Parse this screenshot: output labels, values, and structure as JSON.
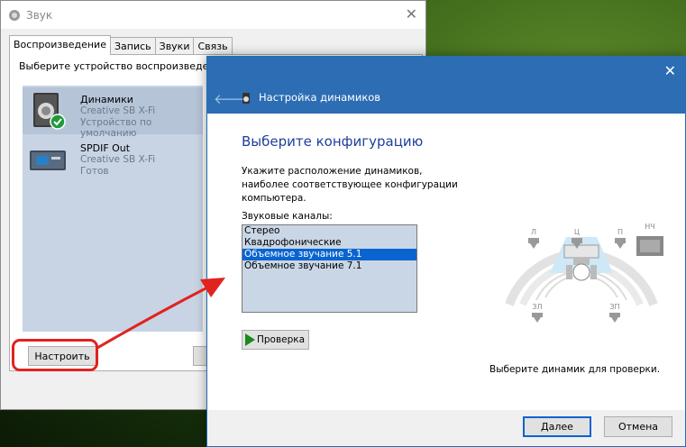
{
  "sound_window": {
    "title": "Звук",
    "tabs": [
      {
        "label": "Воспроизведение",
        "active": true
      },
      {
        "label": "Запись",
        "active": false
      },
      {
        "label": "Звуки",
        "active": false
      },
      {
        "label": "Связь",
        "active": false
      }
    ],
    "instruction": "Выберите устройство воспроизведения",
    "devices": [
      {
        "name": "Динамики",
        "driver": "Creative SB X-Fi",
        "status": "Устройство по умолчанию",
        "selected": true
      },
      {
        "name": "SPDIF Out",
        "driver": "Creative SB X-Fi",
        "status": "Готов",
        "selected": false
      }
    ],
    "configure_button": "Настроить"
  },
  "dialog": {
    "title": "Настройка динамиков",
    "heading": "Выберите конфигурацию",
    "description": "Укажите расположение динамиков, наиболее соответствующее конфигурации компьютера.",
    "channels_label": "Звуковые каналы:",
    "channels": [
      {
        "label": "Стерео",
        "selected": false
      },
      {
        "label": "Квадрофонические",
        "selected": false
      },
      {
        "label": "Объемное звучание 5.1",
        "selected": true
      },
      {
        "label": "Объемное звучание 7.1",
        "selected": false
      }
    ],
    "test_button": "Проверка",
    "speaker_labels": {
      "subwoofer": "НЧ",
      "front_left": "Л",
      "center": "Ц",
      "front_right": "П",
      "rear_left": "ЗЛ",
      "rear_right": "ЗП"
    },
    "test_hint": "Выберите динамик для проверки.",
    "next_button": "Далее",
    "cancel_button": "Отмена"
  },
  "colors": {
    "header_blue": "#2d6db4",
    "heading_blue": "#1e3f9a",
    "selection_blue": "#0a64d0",
    "highlight_red": "#e0231f"
  }
}
